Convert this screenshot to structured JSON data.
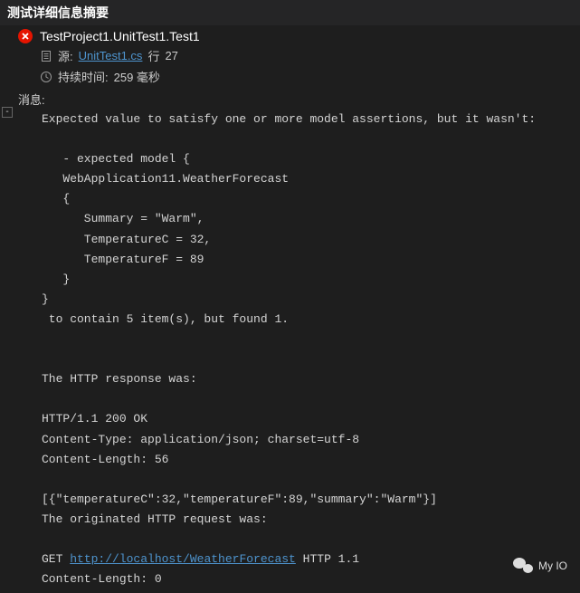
{
  "header": {
    "title": "测试详细信息摘要"
  },
  "test": {
    "full_name": "TestProject1.UnitTest1.Test1",
    "source_label": "源: ",
    "source_file": "UnitTest1.cs",
    "source_line_label": " 行 ",
    "source_line": "27",
    "duration_label": "持续时间: ",
    "duration_value": "259 毫秒"
  },
  "message": {
    "label": "消息:",
    "body_line1": "Expected value to satisfy one or more model assertions, but it wasn't:",
    "body_line2": "",
    "body_line3": "   - expected model {",
    "body_line4": "   WebApplication11.WeatherForecast",
    "body_line5": "   {",
    "body_line6": "      Summary = \"Warm\",",
    "body_line7": "      TemperatureC = 32,",
    "body_line8": "      TemperatureF = 89",
    "body_line9": "   }",
    "body_line10": "}",
    "body_line11": " to contain 5 item(s), but found 1.",
    "body_line12": "",
    "body_line13": "",
    "body_line14": "The HTTP response was:",
    "body_line15": "",
    "body_line16": "HTTP/1.1 200 OK",
    "body_line17": "Content-Type: application/json; charset=utf-8",
    "body_line18": "Content-Length: 56",
    "body_line19": "",
    "body_line20": "[{\"temperatureC\":32,\"temperatureF\":89,\"summary\":\"Warm\"}]",
    "body_line21": "The originated HTTP request was:",
    "body_line22": "",
    "body_line23_prefix": "GET ",
    "body_line23_link": "http://localhost/WeatherForecast",
    "body_line23_suffix": " HTTP 1.1",
    "body_line24": "Content-Length: 0"
  },
  "watermark": {
    "text": "My IO"
  }
}
